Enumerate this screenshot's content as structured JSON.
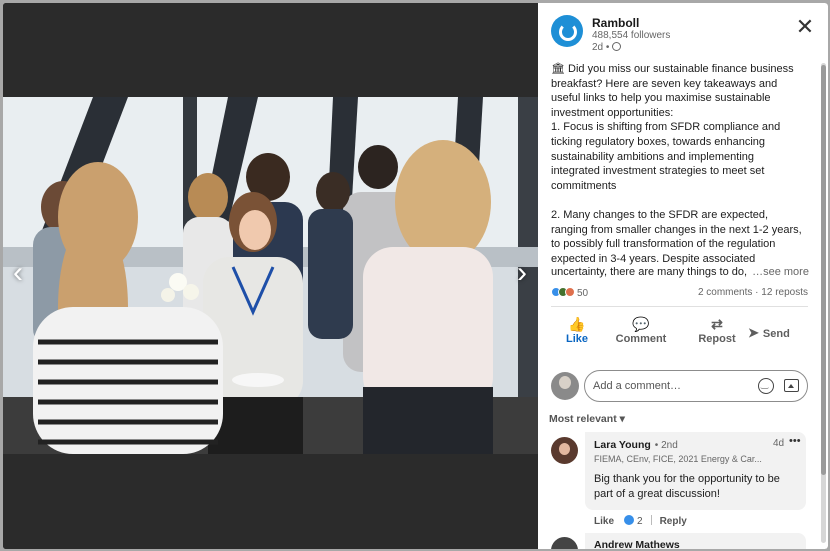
{
  "viewer": {
    "prev_glyph": "‹",
    "next_glyph": "›"
  },
  "post": {
    "company": "Ramboll",
    "followers": "488,554 followers",
    "age": "2d •",
    "close_glyph": "✕",
    "body": "🏛 Did you miss our sustainable finance business breakfast? Here are seven key takeaways and useful links to help you maximise sustainable investment opportunities:\n1. Focus is shifting from SFDR compliance and ticking regulatory boxes, towards enhancing sustainability ambitions and implementing integrated investment strategies to meet set commitments\n\n2. Many changes to the SFDR are expected, ranging from smaller changes in the next 1-2 years, to possibly full transformation of the regulation expected in 3-4 years. Despite associated",
    "body_tail": "uncertainty, there are many things to do,",
    "see_more": "…see more",
    "reaction_count": "50",
    "comments_count": "2 comments",
    "reposts_count": "12 reposts",
    "reaction_colors": [
      "#378fe9",
      "#44712e",
      "#df704d"
    ]
  },
  "actions": [
    {
      "label": "Like",
      "icon": "thumbs-up-icon",
      "glyph": "👍"
    },
    {
      "label": "Comment",
      "icon": "speech-bubble-icon",
      "glyph": "💬"
    },
    {
      "label": "Repost",
      "icon": "repost-arrows-icon",
      "glyph": "⇄"
    },
    {
      "label": "Send",
      "icon": "paper-plane-icon",
      "glyph": "➤"
    }
  ],
  "composer": {
    "placeholder": "Add a comment…"
  },
  "sort": {
    "label": "Most relevant ▾"
  },
  "comments": [
    {
      "name": "Lara Young",
      "degree": "• 2nd",
      "headline": "FIEMA, CEnv, FICE, 2021 Energy & Car...",
      "time": "4d",
      "more": "•••",
      "text": "Big thank you for the opportunity to be part of a great discussion!",
      "like_label": "Like",
      "like_count": "2",
      "reply_label": "Reply"
    }
  ],
  "next_comment": {
    "name_partial": "Andrew Mathews",
    "more": "•••"
  }
}
